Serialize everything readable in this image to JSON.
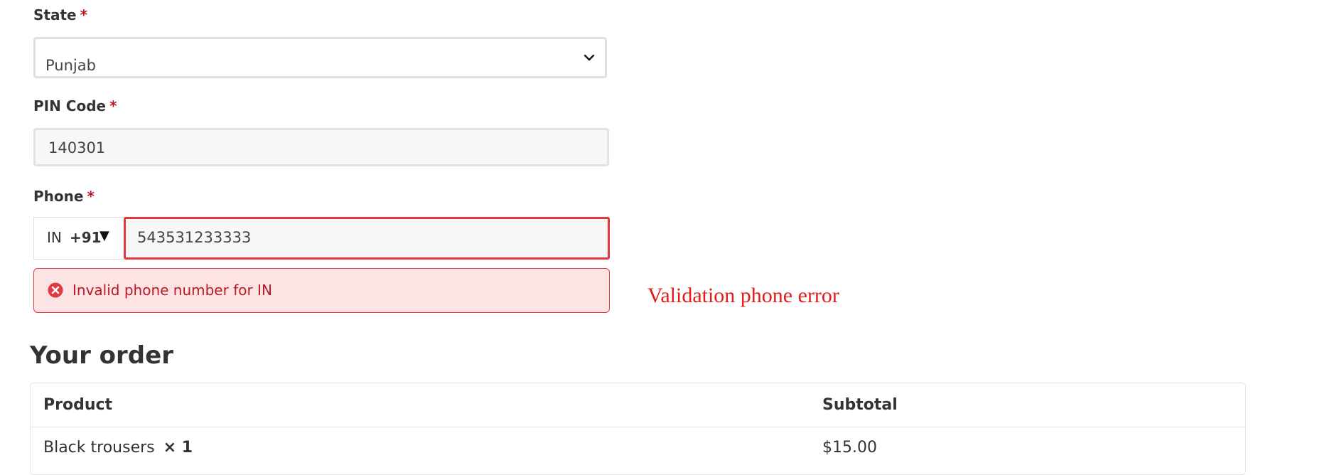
{
  "form": {
    "state": {
      "label": "State",
      "required_mark": "*",
      "selected_value": "Punjab"
    },
    "pin_code": {
      "label": "PIN Code",
      "required_mark": "*",
      "value": "140301"
    },
    "phone": {
      "label": "Phone",
      "required_mark": "*",
      "country_code": "IN",
      "dial_code": "+91",
      "dropdown_arrow": "▼",
      "value": "543531233333",
      "error_message": "Invalid phone number for IN"
    }
  },
  "annotation": {
    "text": "Validation phone error",
    "color": "#e31b1b"
  },
  "order": {
    "heading": "Your order",
    "columns": [
      "Product",
      "Subtotal"
    ],
    "rows": [
      {
        "product": "Black trousers",
        "quantity": "× 1",
        "subtotal": "$15.00"
      }
    ]
  },
  "colors": {
    "required": "#b81c23",
    "error_border": "#e0393e",
    "error_background": "#fde3e4",
    "input_background": "#f7f7f7"
  },
  "icons": {
    "select_chevron": "chevron-down-icon",
    "error": "error-circle-x-icon"
  }
}
